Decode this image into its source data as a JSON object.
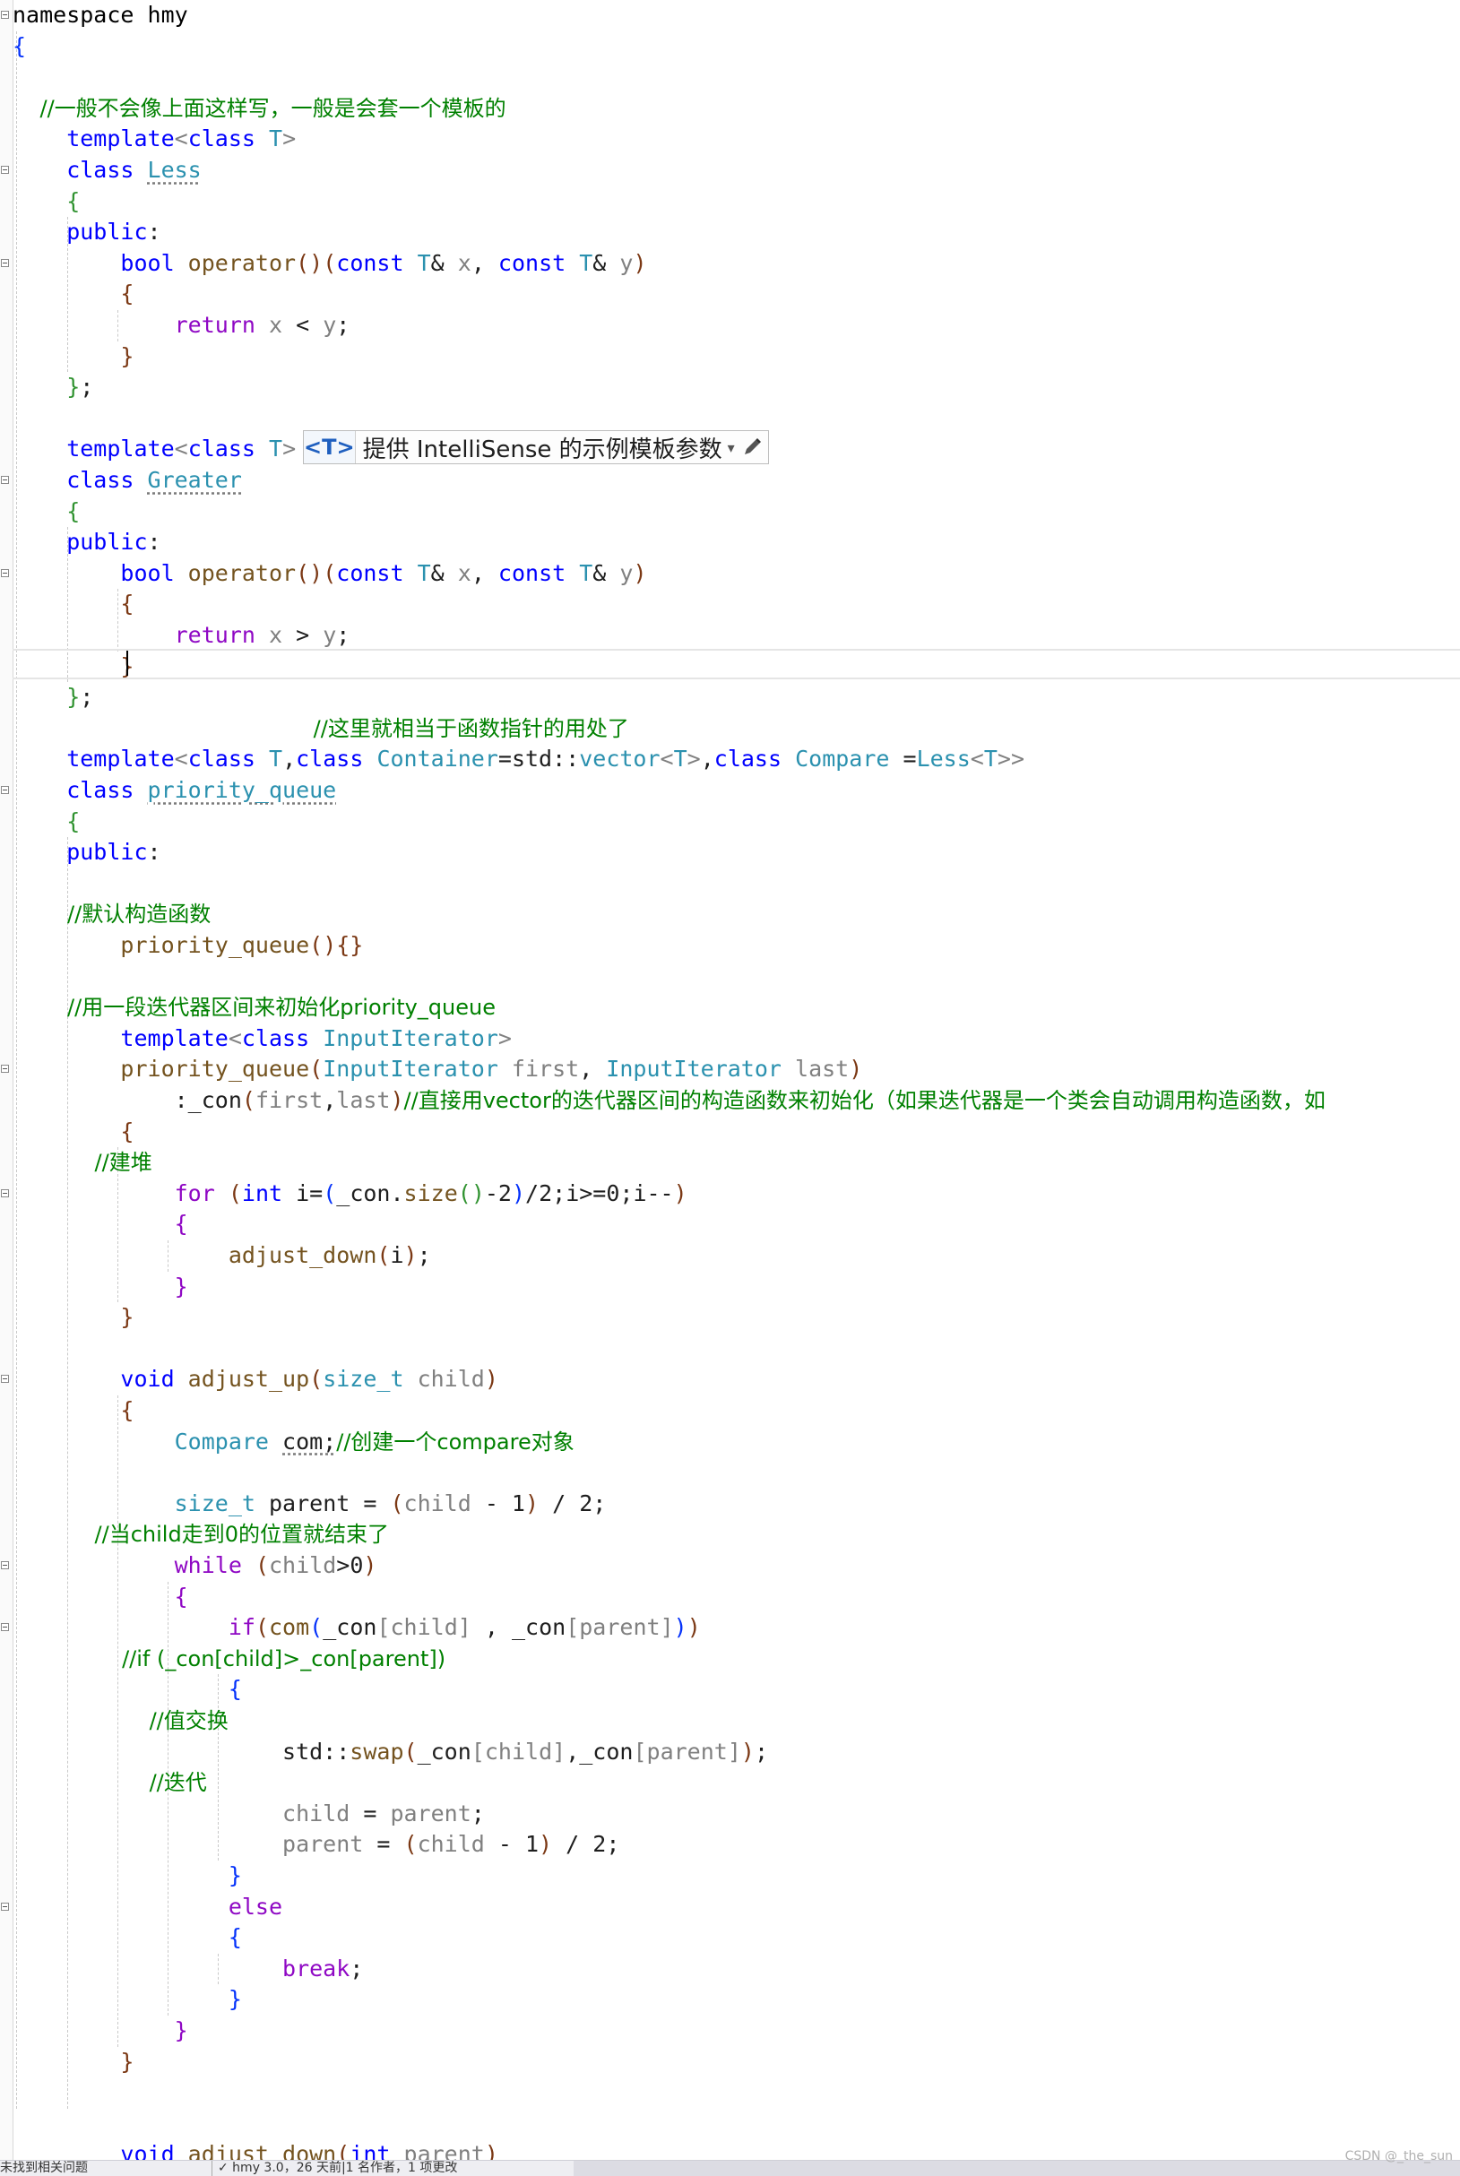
{
  "editor": {
    "lines": [
      [
        [
          "ns",
          "namespace hmy"
        ]
      ],
      [
        [
          "br1",
          "{"
        ]
      ],
      [],
      [
        [
          "cm",
          "    //一般不会像上面这样写，一般是会套一个模板的"
        ]
      ],
      [
        [
          "kw",
          "    template"
        ],
        [
          "pn",
          "<"
        ],
        [
          "kw",
          "class"
        ],
        [
          "mem",
          " "
        ],
        [
          "tp",
          "T"
        ],
        [
          "pn",
          ">"
        ]
      ],
      [
        [
          "kw",
          "    class "
        ],
        [
          "ty",
          "Less"
        ]
      ],
      [
        [
          "br2",
          "    {"
        ]
      ],
      [
        [
          "kw",
          "    public"
        ],
        [
          "mem",
          ":"
        ]
      ],
      [
        [
          "kw",
          "        bool "
        ],
        [
          "fn",
          "operator"
        ],
        [
          "br3",
          "()"
        ],
        [
          "br3",
          "("
        ],
        [
          "kw",
          "const "
        ],
        [
          "ty",
          "T"
        ],
        [
          "mem",
          "& "
        ],
        [
          "par",
          "x"
        ],
        [
          "mem",
          ", "
        ],
        [
          "kw",
          "const "
        ],
        [
          "ty",
          "T"
        ],
        [
          "mem",
          "& "
        ],
        [
          "par",
          "y"
        ],
        [
          "br3",
          ")"
        ]
      ],
      [
        [
          "br3",
          "        {"
        ]
      ],
      [
        [
          "ctl",
          "            return "
        ],
        [
          "par",
          "x"
        ],
        [
          "mem",
          " < "
        ],
        [
          "par",
          "y"
        ],
        [
          "mem",
          ";"
        ]
      ],
      [
        [
          "br3",
          "        }"
        ]
      ],
      [
        [
          "br2",
          "    }"
        ],
        [
          "mem",
          ";"
        ]
      ],
      [],
      [
        [
          "kw",
          "    template"
        ],
        [
          "pn",
          "<"
        ],
        [
          "kw",
          "class"
        ],
        [
          "mem",
          " "
        ],
        [
          "tp",
          "T"
        ],
        [
          "pn",
          ">"
        ]
      ],
      [
        [
          "kw",
          "    class "
        ],
        [
          "ty",
          "Greater"
        ]
      ],
      [
        [
          "br2",
          "    {"
        ]
      ],
      [
        [
          "kw",
          "    public"
        ],
        [
          "mem",
          ":"
        ]
      ],
      [
        [
          "kw",
          "        bool "
        ],
        [
          "fn",
          "operator"
        ],
        [
          "br3",
          "()"
        ],
        [
          "br3",
          "("
        ],
        [
          "kw",
          "const "
        ],
        [
          "ty",
          "T"
        ],
        [
          "mem",
          "& "
        ],
        [
          "par",
          "x"
        ],
        [
          "mem",
          ", "
        ],
        [
          "kw",
          "const "
        ],
        [
          "ty",
          "T"
        ],
        [
          "mem",
          "& "
        ],
        [
          "par",
          "y"
        ],
        [
          "br3",
          ")"
        ]
      ],
      [
        [
          "br3",
          "        {"
        ]
      ],
      [
        [
          "ctl",
          "            return "
        ],
        [
          "par",
          "x"
        ],
        [
          "mem",
          " > "
        ],
        [
          "par",
          "y"
        ],
        [
          "mem",
          ";"
        ]
      ],
      [
        [
          "br3",
          "        }"
        ]
      ],
      [
        [
          "br2",
          "    }"
        ],
        [
          "mem",
          ";"
        ]
      ],
      [
        [
          "cm",
          "                                            //这里就相当于函数指针的用处了"
        ]
      ],
      [
        [
          "kw",
          "    template"
        ],
        [
          "pn",
          "<"
        ],
        [
          "kw",
          "class "
        ],
        [
          "ty",
          "T"
        ],
        [
          "mem",
          ","
        ],
        [
          "kw",
          "class "
        ],
        [
          "ty",
          "Container"
        ],
        [
          "mem",
          "=std::"
        ],
        [
          "ty",
          "vector"
        ],
        [
          "pn",
          "<"
        ],
        [
          "ty",
          "T"
        ],
        [
          "pn",
          ">"
        ],
        [
          "mem",
          ","
        ],
        [
          "kw",
          "class "
        ],
        [
          "ty",
          "Compare "
        ],
        [
          "mem",
          "="
        ],
        [
          "ty",
          "Less"
        ],
        [
          "pn",
          "<"
        ],
        [
          "ty",
          "T"
        ],
        [
          "pn",
          ">>"
        ]
      ],
      [
        [
          "kw",
          "    class "
        ],
        [
          "ty",
          "priority_queue"
        ]
      ],
      [
        [
          "br2",
          "    {"
        ]
      ],
      [
        [
          "kw",
          "    public"
        ],
        [
          "mem",
          ":"
        ]
      ],
      [],
      [
        [
          "cm",
          "        //默认构造函数"
        ]
      ],
      [
        [
          "fn",
          "        priority_queue"
        ],
        [
          "br3",
          "()"
        ],
        [
          "br3",
          "{}"
        ]
      ],
      [],
      [
        [
          "cm",
          "        //用一段迭代器区间来初始化priority_queue"
        ]
      ],
      [
        [
          "kw",
          "        template"
        ],
        [
          "pn",
          "<"
        ],
        [
          "kw",
          "class "
        ],
        [
          "ty",
          "InputIterator"
        ],
        [
          "pn",
          ">"
        ]
      ],
      [
        [
          "fn",
          "        priority_queue"
        ],
        [
          "br3",
          "("
        ],
        [
          "ty",
          "InputIterator "
        ],
        [
          "par",
          "first"
        ],
        [
          "mem",
          ", "
        ],
        [
          "ty",
          "InputIterator "
        ],
        [
          "par",
          "last"
        ],
        [
          "br3",
          ")"
        ]
      ],
      [
        [
          "mem",
          "            :_con"
        ],
        [
          "br3",
          "("
        ],
        [
          "par",
          "first"
        ],
        [
          "mem",
          ","
        ],
        [
          "par",
          "last"
        ],
        [
          "br3",
          ")"
        ],
        [
          "cm",
          "//直接用vector的迭代器区间的构造函数来初始化（如果迭代器是一个类会自动调用构造函数，如"
        ]
      ],
      [
        [
          "br3",
          "        {"
        ]
      ],
      [
        [
          "cm",
          "            //建堆"
        ]
      ],
      [
        [
          "ctl",
          "            for "
        ],
        [
          "br3",
          "("
        ],
        [
          "kw",
          "int "
        ],
        [
          "mem",
          "i="
        ],
        [
          "br1",
          "("
        ],
        [
          "mem",
          "_con."
        ],
        [
          "fn",
          "size"
        ],
        [
          "br2",
          "()"
        ],
        [
          "mem",
          "-2"
        ],
        [
          "br1",
          ")"
        ],
        [
          "mem",
          "/2;i>=0;i--"
        ],
        [
          "br3",
          ")"
        ]
      ],
      [
        [
          "ctl",
          "            {"
        ]
      ],
      [
        [
          "fn",
          "                adjust_down"
        ],
        [
          "br3",
          "("
        ],
        [
          "mem",
          "i"
        ],
        [
          "br3",
          ")"
        ],
        [
          "mem",
          ";"
        ]
      ],
      [
        [
          "ctl",
          "            }"
        ]
      ],
      [
        [
          "br3",
          "        }"
        ]
      ],
      [],
      [
        [
          "kw",
          "        void "
        ],
        [
          "fn",
          "adjust_up"
        ],
        [
          "br3",
          "("
        ],
        [
          "ty",
          "size_t "
        ],
        [
          "par",
          "child"
        ],
        [
          "br3",
          ")"
        ]
      ],
      [
        [
          "br3",
          "        {"
        ]
      ],
      [
        [
          "ty",
          "            Compare "
        ],
        [
          "mem",
          "com;"
        ],
        [
          "cm",
          "//创建一个compare对象"
        ]
      ],
      [],
      [
        [
          "ty",
          "            size_t "
        ],
        [
          "mem",
          "parent = "
        ],
        [
          "br3",
          "("
        ],
        [
          "par",
          "child"
        ],
        [
          "mem",
          " - 1"
        ],
        [
          "br3",
          ")"
        ],
        [
          "mem",
          " / 2;"
        ]
      ],
      [
        [
          "cm",
          "            //当child走到0的位置就结束了"
        ]
      ],
      [
        [
          "ctl",
          "            while "
        ],
        [
          "br3",
          "("
        ],
        [
          "par",
          "child"
        ],
        [
          "mem",
          ">0"
        ],
        [
          "br3",
          ")"
        ]
      ],
      [
        [
          "ctl",
          "            {"
        ]
      ],
      [
        [
          "ctl",
          "                if"
        ],
        [
          "br3",
          "("
        ],
        [
          "fn",
          "com"
        ],
        [
          "br1",
          "("
        ],
        [
          "mem",
          "_con"
        ],
        [
          "pn",
          "["
        ],
        [
          "par",
          "child"
        ],
        [
          "pn",
          "]"
        ],
        [
          "mem",
          " , _con"
        ],
        [
          "pn",
          "["
        ],
        [
          "par",
          "parent"
        ],
        [
          "pn",
          "]"
        ],
        [
          "br1",
          ")"
        ],
        [
          "br3",
          ")"
        ]
      ],
      [
        [
          "cm",
          "                //if (_con[child]>_con[parent])"
        ]
      ],
      [
        [
          "br1",
          "                {"
        ]
      ],
      [
        [
          "cm",
          "                    //值交换"
        ]
      ],
      [
        [
          "mem",
          "                    std::"
        ],
        [
          "fn",
          "swap"
        ],
        [
          "br3",
          "("
        ],
        [
          "mem",
          "_con"
        ],
        [
          "pn",
          "["
        ],
        [
          "par",
          "child"
        ],
        [
          "pn",
          "]"
        ],
        [
          "mem",
          ",_con"
        ],
        [
          "pn",
          "["
        ],
        [
          "par",
          "parent"
        ],
        [
          "pn",
          "]"
        ],
        [
          "br3",
          ")"
        ],
        [
          "mem",
          ";"
        ]
      ],
      [
        [
          "cm",
          "                    //迭代"
        ]
      ],
      [
        [
          "par",
          "                    child"
        ],
        [
          "mem",
          " = "
        ],
        [
          "par",
          "parent"
        ],
        [
          "mem",
          ";"
        ]
      ],
      [
        [
          "par",
          "                    parent"
        ],
        [
          "mem",
          " = "
        ],
        [
          "br3",
          "("
        ],
        [
          "par",
          "child"
        ],
        [
          "mem",
          " - 1"
        ],
        [
          "br3",
          ")"
        ],
        [
          "mem",
          " / 2;"
        ]
      ],
      [
        [
          "br1",
          "                }"
        ]
      ],
      [
        [
          "ctl",
          "                else"
        ]
      ],
      [
        [
          "br1",
          "                {"
        ]
      ],
      [
        [
          "ctl",
          "                    break"
        ],
        [
          "mem",
          ";"
        ]
      ],
      [
        [
          "br1",
          "                }"
        ]
      ],
      [
        [
          "ctl",
          "            }"
        ]
      ],
      [
        [
          "br3",
          "        }"
        ]
      ],
      [],
      [],
      [
        [
          "kw",
          "        void "
        ],
        [
          "fn",
          "adjust_down"
        ],
        [
          "br3",
          "("
        ],
        [
          "kw",
          "int "
        ],
        [
          "par",
          "parent"
        ],
        [
          "br3",
          ")"
        ]
      ]
    ]
  },
  "intellisense": {
    "tag": "<T>",
    "text": "提供 IntelliSense 的示例模板参数",
    "dropdown": "▾",
    "edit_icon": "pencil-icon"
  },
  "statusbar": {
    "left": "未找到相关问题",
    "info": "✓ hmy 3.0，26 天前|1 名作者，1 项更改"
  },
  "watermark": "CSDN @_the_sun"
}
